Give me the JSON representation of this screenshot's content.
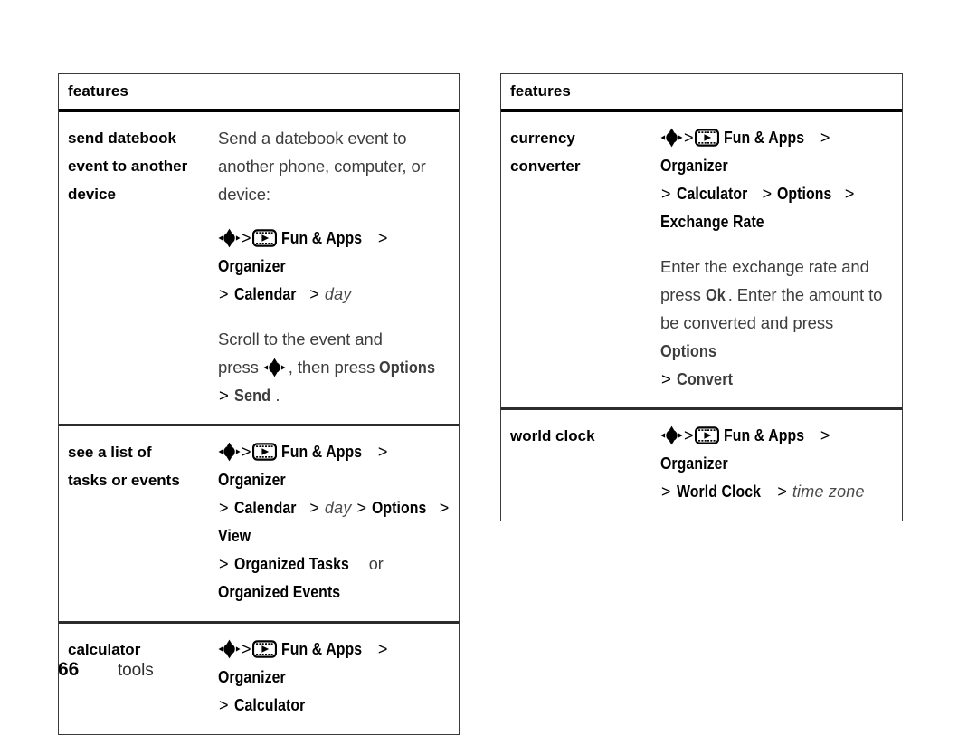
{
  "document": {
    "footer": {
      "page_number": "66",
      "section": "tools"
    }
  },
  "icons": {
    "nav_key": "navigation-key-icon",
    "fun_apps": "film-strip-play-icon"
  },
  "colors": {
    "text": "#000000",
    "prose": "#3d3d3d",
    "rule": "#2c2c2c",
    "border": "#3a3a3a",
    "page_bg": "#ffffff"
  },
  "tables": {
    "left": {
      "header": "features",
      "rows": [
        {
          "label": "send datebook event to another device",
          "label_lines": [
            "send datebook",
            "event to another",
            "device"
          ],
          "paragraphs": [
            {
              "kind": "prose",
              "text": "Send a datebook event to another phone, computer, or device:"
            },
            {
              "kind": "path",
              "segments": [
                {
                  "type": "icon",
                  "value": "navigation-key-icon"
                },
                {
                  "type": "sep",
                  "value": ">"
                },
                {
                  "type": "icon",
                  "value": "film-strip-play-icon"
                },
                {
                  "type": "menu",
                  "value": "Fun & Apps"
                },
                {
                  "type": "sep",
                  "value": ">"
                },
                {
                  "type": "menu",
                  "value": "Organizer"
                },
                {
                  "type": "sep",
                  "value": ">"
                },
                {
                  "type": "menu",
                  "value": "Calendar"
                },
                {
                  "type": "sep",
                  "value": ">"
                },
                {
                  "type": "var",
                  "value": "day"
                }
              ]
            },
            {
              "kind": "mixed",
              "text": "Scroll to the event and press [nav], then press Options > Send."
            }
          ]
        },
        {
          "label": "see a list of tasks or events",
          "label_lines": [
            "see a list of",
            "tasks or events"
          ],
          "paragraphs": [
            {
              "kind": "path",
              "segments": [
                {
                  "type": "icon",
                  "value": "navigation-key-icon"
                },
                {
                  "type": "sep",
                  "value": ">"
                },
                {
                  "type": "icon",
                  "value": "film-strip-play-icon"
                },
                {
                  "type": "menu",
                  "value": "Fun & Apps"
                },
                {
                  "type": "sep",
                  "value": ">"
                },
                {
                  "type": "menu",
                  "value": "Organizer"
                },
                {
                  "type": "sep",
                  "value": ">"
                },
                {
                  "type": "menu",
                  "value": "Calendar"
                },
                {
                  "type": "sep",
                  "value": ">"
                },
                {
                  "type": "var",
                  "value": "day"
                },
                {
                  "type": "sep",
                  "value": ">"
                },
                {
                  "type": "menu",
                  "value": "Options"
                },
                {
                  "type": "sep",
                  "value": ">"
                },
                {
                  "type": "menu",
                  "value": "View"
                },
                {
                  "type": "sep",
                  "value": ">"
                },
                {
                  "type": "menu",
                  "value": "Organized Tasks"
                },
                {
                  "type": "word",
                  "value": "or"
                },
                {
                  "type": "menu",
                  "value": "Organized Events"
                }
              ]
            }
          ]
        },
        {
          "label": "calculator",
          "label_lines": [
            "calculator"
          ],
          "paragraphs": [
            {
              "kind": "path",
              "segments": [
                {
                  "type": "icon",
                  "value": "navigation-key-icon"
                },
                {
                  "type": "sep",
                  "value": ">"
                },
                {
                  "type": "icon",
                  "value": "film-strip-play-icon"
                },
                {
                  "type": "menu",
                  "value": "Fun & Apps"
                },
                {
                  "type": "sep",
                  "value": ">"
                },
                {
                  "type": "menu",
                  "value": "Organizer"
                },
                {
                  "type": "sep",
                  "value": ">"
                },
                {
                  "type": "menu",
                  "value": "Calculator"
                }
              ]
            }
          ]
        }
      ]
    },
    "right": {
      "header": "features",
      "rows": [
        {
          "label": "currency converter",
          "label_lines": [
            "currency",
            "converter"
          ],
          "paragraphs": [
            {
              "kind": "path",
              "segments": [
                {
                  "type": "icon",
                  "value": "navigation-key-icon"
                },
                {
                  "type": "sep",
                  "value": ">"
                },
                {
                  "type": "icon",
                  "value": "film-strip-play-icon"
                },
                {
                  "type": "menu",
                  "value": "Fun & Apps"
                },
                {
                  "type": "sep",
                  "value": ">"
                },
                {
                  "type": "menu",
                  "value": "Organizer"
                },
                {
                  "type": "sep",
                  "value": ">"
                },
                {
                  "type": "menu",
                  "value": "Calculator"
                },
                {
                  "type": "sep",
                  "value": ">"
                },
                {
                  "type": "menu",
                  "value": "Options"
                },
                {
                  "type": "sep",
                  "value": ">"
                },
                {
                  "type": "menu",
                  "value": "Exchange Rate"
                }
              ]
            },
            {
              "kind": "mixed",
              "text": "Enter the exchange rate and press Ok. Enter the amount to be converted and press Options > Convert"
            }
          ]
        },
        {
          "label": "world clock",
          "label_lines": [
            "world clock"
          ],
          "paragraphs": [
            {
              "kind": "path",
              "segments": [
                {
                  "type": "icon",
                  "value": "navigation-key-icon"
                },
                {
                  "type": "sep",
                  "value": ">"
                },
                {
                  "type": "icon",
                  "value": "film-strip-play-icon"
                },
                {
                  "type": "menu",
                  "value": "Fun & Apps"
                },
                {
                  "type": "sep",
                  "value": ">"
                },
                {
                  "type": "menu",
                  "value": "Organizer"
                },
                {
                  "type": "sep",
                  "value": ">"
                },
                {
                  "type": "menu",
                  "value": "World Clock"
                },
                {
                  "type": "sep",
                  "value": ">"
                },
                {
                  "type": "var",
                  "value": "time zone"
                }
              ]
            }
          ]
        }
      ]
    }
  },
  "strings": {
    "left": {
      "r1_prose_l1": "Send a datebook event to",
      "r1_prose_l2": "another phone, computer, or",
      "r1_prose_l3": "device:",
      "r1_p3_a": "Scroll to the event and",
      "r1_p3_b": "press",
      "r1_p3_c": ", then press",
      "r1_p3_options": "Options",
      "r1_p3_gt": ">",
      "r1_p3_send": "Send",
      "r1_p3_period": ".",
      "fun_apps": "Fun & Apps",
      "organizer": "Organizer",
      "calendar": "Calendar",
      "day": "day",
      "options": "Options",
      "view": "View",
      "organized_tasks": "Organized Tasks",
      "or": "or",
      "organized_events": "Organized Events",
      "calculator": "Calculator",
      "gt": ">"
    },
    "right": {
      "fun_apps": "Fun & Apps",
      "organizer": "Organizer",
      "calculator": "Calculator",
      "options": "Options",
      "exchange_rate": "Exchange Rate",
      "p2_l1": "Enter the exchange rate and",
      "p2_l2a": "press",
      "p2_ok": "Ok",
      "p2_l2b": ". Enter the amount to",
      "p2_l3": "be converted and press",
      "p2_options": "Options",
      "p2_gt": ">",
      "p2_convert": "Convert",
      "world_clock": "World Clock",
      "time_zone": "time zone",
      "gt": ">"
    }
  }
}
